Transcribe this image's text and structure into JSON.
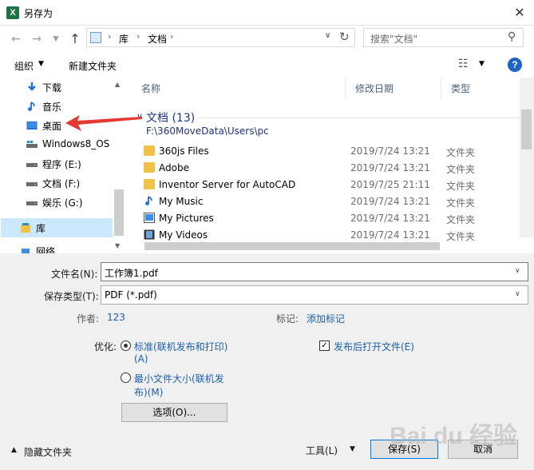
{
  "window": {
    "title": "另存为",
    "app_icon_letter": "X"
  },
  "nav": {
    "address": {
      "crumbs": [
        "库",
        "文档"
      ]
    },
    "search_placeholder": "搜索\"文档\""
  },
  "toolbar": {
    "organize": "组织",
    "new_folder": "新建文件夹"
  },
  "sidebar": {
    "items": [
      {
        "label": "下载",
        "icon": "download-icon"
      },
      {
        "label": "音乐",
        "icon": "music-icon"
      },
      {
        "label": "桌面",
        "icon": "desktop-icon"
      },
      {
        "label": "Windows8_OS",
        "icon": "drive-icon"
      },
      {
        "label": "程序 (E:)",
        "icon": "drive-icon"
      },
      {
        "label": "文档 (F:)",
        "icon": "drive-icon"
      },
      {
        "label": "娱乐 (G:)",
        "icon": "drive-icon"
      },
      {
        "label": "库",
        "icon": "library-icon"
      },
      {
        "label": "网络",
        "icon": "network-icon"
      }
    ]
  },
  "file_list": {
    "columns": [
      "名称",
      "修改日期",
      "类型"
    ],
    "group": {
      "title": "文档 (13)",
      "path": "F:\\360MoveData\\Users\\pc"
    },
    "rows": [
      {
        "name": "360js Files",
        "date": "2019/7/24 13:21",
        "type": "文件夹",
        "icon": "folder-icon"
      },
      {
        "name": "Adobe",
        "date": "2019/7/24 13:21",
        "type": "文件夹",
        "icon": "folder-icon"
      },
      {
        "name": "Inventor Server for AutoCAD",
        "date": "2019/7/25 21:11",
        "type": "文件夹",
        "icon": "folder-icon"
      },
      {
        "name": "My Music",
        "date": "2019/7/24 13:21",
        "type": "文件夹",
        "icon": "music-folder-icon"
      },
      {
        "name": "My Pictures",
        "date": "2019/7/24 13:21",
        "type": "文件夹",
        "icon": "pictures-folder-icon"
      },
      {
        "name": "My Videos",
        "date": "2019/7/24 13:21",
        "type": "文件夹",
        "icon": "videos-folder-icon"
      }
    ]
  },
  "form": {
    "filename_label": "文件名(N):",
    "filename_value": "工作簿1.pdf",
    "filetype_label": "保存类型(T):",
    "filetype_value": "PDF (*.pdf)",
    "author_label": "作者:",
    "author_value": "123",
    "tags_label": "标记:",
    "tags_value": "添加标记",
    "optimize_label": "优化:",
    "radio_standard_line1": "标准(联机发布和打印)",
    "radio_standard_line2": "(A)",
    "radio_min_line1": "最小文件大小(联机发",
    "radio_min_line2": "布)(M)",
    "open_after_publish": "发布后打开文件(E)",
    "options_button": "选项(O)..."
  },
  "footer": {
    "hide_folders": "隐藏文件夹",
    "tools": "工具(L)",
    "save": "保存(S)",
    "cancel": "取消"
  },
  "watermark_text": "Bai du 经验",
  "colors": {
    "accent": "#0078d7",
    "link": "#1a5fb4",
    "selection": "#cce8ff",
    "group_header": "#1e3287",
    "annotation_arrow": "#e53935"
  }
}
